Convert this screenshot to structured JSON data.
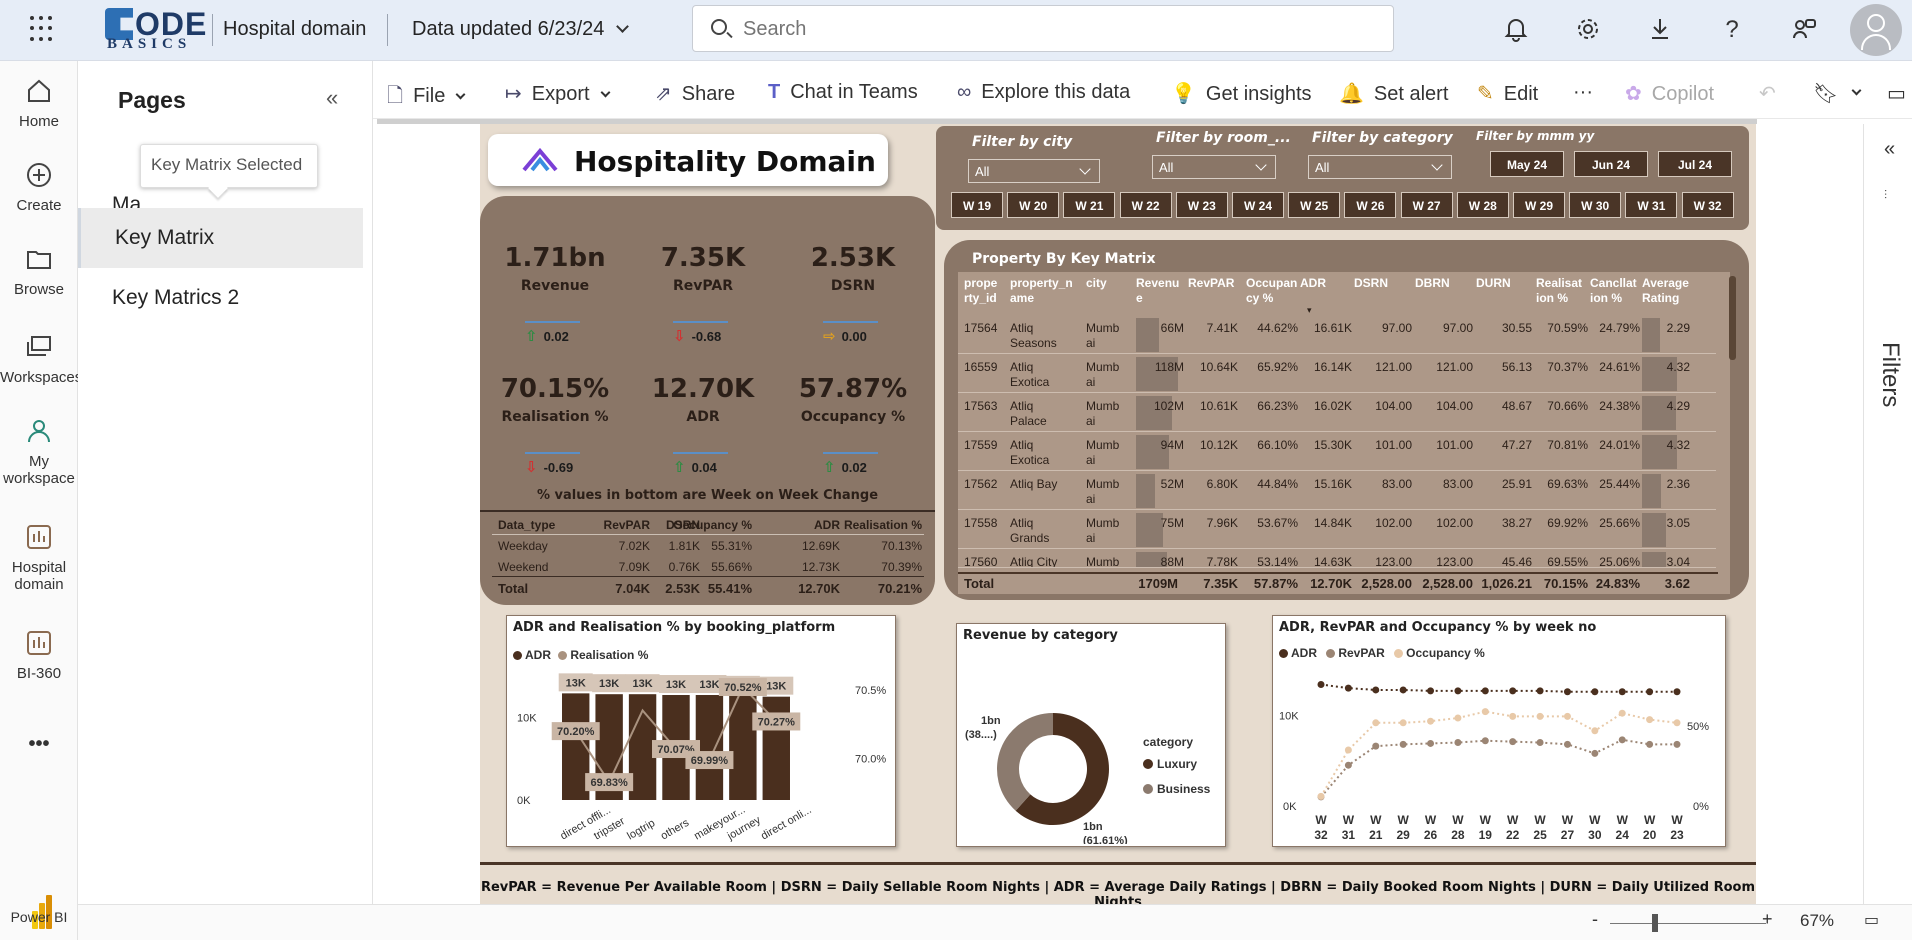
{
  "topbar": {
    "logo_main": "ODE",
    "logo_sub": "BASICS",
    "workspace": "Hospital domain",
    "data_updated": "Data updated 6/23/24",
    "search_placeholder": "Search"
  },
  "leftnav": {
    "home": "Home",
    "create": "Create",
    "browse": "Browse",
    "workspaces": "Workspaces",
    "my_ws_1": "My",
    "my_ws_2": "workspace",
    "hosp_1": "Hospital",
    "hosp_2": "domain",
    "bi360": "BI-360",
    "more": "•••",
    "powerbi": "Power BI"
  },
  "pages": {
    "title": "Pages",
    "collapse": "«",
    "item1": "Ma",
    "item2": "Key Matrix",
    "item3": "Key Matrics 2",
    "tooltip": "Key Matrix Selected"
  },
  "actions": {
    "file": "File",
    "export": "Export",
    "share": "Share",
    "teams": "Chat in Teams",
    "explore": "Explore this data",
    "insights": "Get insights",
    "alert": "Set alert",
    "edit": "Edit",
    "more": "···",
    "copilot": "Copilot"
  },
  "report": {
    "brand": "Hospitality Domain",
    "kpis": [
      {
        "value": "1.71bn",
        "label": "Revenue",
        "delta": "0.02",
        "dir": "up"
      },
      {
        "value": "7.35K",
        "label": "RevPAR",
        "delta": "-0.68",
        "dir": "down"
      },
      {
        "value": "2.53K",
        "label": "DSRN",
        "delta": "0.00",
        "dir": "flat"
      },
      {
        "value": "70.15%",
        "label": "Realisation %",
        "delta": "-0.69",
        "dir": "down"
      },
      {
        "value": "12.70K",
        "label": "ADR",
        "delta": "0.04",
        "dir": "up"
      },
      {
        "value": "57.87%",
        "label": "Occupancy %",
        "delta": "0.02",
        "dir": "up"
      }
    ],
    "wow_note": "% values in bottom are Week on Week Change",
    "mini_table": {
      "headers": [
        "Data_type",
        "RevPAR",
        "DSRN",
        "Occupancy %",
        "ADR",
        "Realisation %"
      ],
      "rows": [
        [
          "Weekday",
          "7.02K",
          "1.81K",
          "55.31%",
          "12.69K",
          "70.13%"
        ],
        [
          "Weekend",
          "7.09K",
          "0.76K",
          "55.66%",
          "12.73K",
          "70.39%"
        ],
        [
          "Total",
          "7.04K",
          "2.53K",
          "55.41%",
          "12.70K",
          "70.21%"
        ]
      ]
    },
    "filters": {
      "city_label": "Filter by city",
      "city_value": "All",
      "room_label": "Filter by room_...",
      "room_value": "All",
      "category_label": "Filter by category",
      "category_value": "All",
      "month_label": "Filter by mmm yy",
      "months": [
        "May 24",
        "Jun 24",
        "Jul 24"
      ],
      "weeks": [
        "W 19",
        "W 20",
        "W 21",
        "W 22",
        "W 23",
        "W 24",
        "W 25",
        "W 26",
        "W 27",
        "W 28",
        "W 29",
        "W 30",
        "W 31",
        "W 32"
      ]
    },
    "property_table": {
      "title": "Property By Key Matrix",
      "headers": [
        "prope\nrty_id",
        "property_n\name",
        "city",
        "Revenu\ne",
        "RevPAR",
        "Occupan\ncy %",
        "ADR",
        "DSRN",
        "DBRN",
        "DURN",
        "Realisat\nion %",
        "Cancllat\nion %",
        "Average\nRating"
      ],
      "rows": [
        {
          "id": "17564",
          "name1": "Atliq",
          "name2": "Seasons",
          "city1": "Mumb",
          "city2": "ai",
          "revenue": "66M",
          "revpar": "7.41K",
          "occ": "44.62%",
          "adr": "16.61K",
          "dsrn": "97.00",
          "dbrn": "97.00",
          "durn": "30.55",
          "real": "70.59%",
          "canc": "24.79%",
          "rating": "2.29",
          "rev_val": 66,
          "rating_val": 2.29
        },
        {
          "id": "16559",
          "name1": "Atliq",
          "name2": "Exotica",
          "city1": "Mumb",
          "city2": "ai",
          "revenue": "118M",
          "revpar": "10.64K",
          "occ": "65.92%",
          "adr": "16.14K",
          "dsrn": "121.00",
          "dbrn": "121.00",
          "durn": "56.13",
          "real": "70.37%",
          "canc": "24.61%",
          "rating": "4.32",
          "rev_val": 118,
          "rating_val": 4.32
        },
        {
          "id": "17563",
          "name1": "Atliq",
          "name2": "Palace",
          "city1": "Mumb",
          "city2": "ai",
          "revenue": "102M",
          "revpar": "10.61K",
          "occ": "66.23%",
          "adr": "16.02K",
          "dsrn": "104.00",
          "dbrn": "104.00",
          "durn": "48.67",
          "real": "70.66%",
          "canc": "24.38%",
          "rating": "4.29",
          "rev_val": 102,
          "rating_val": 4.29
        },
        {
          "id": "17559",
          "name1": "Atliq",
          "name2": "Exotica",
          "city1": "Mumb",
          "city2": "ai",
          "revenue": "94M",
          "revpar": "10.12K",
          "occ": "66.10%",
          "adr": "15.30K",
          "dsrn": "101.00",
          "dbrn": "101.00",
          "durn": "47.27",
          "real": "70.81%",
          "canc": "24.01%",
          "rating": "4.32",
          "rev_val": 94,
          "rating_val": 4.32
        },
        {
          "id": "17562",
          "name1": "Atliq Bay",
          "name2": "",
          "city1": "Mumb",
          "city2": "ai",
          "revenue": "52M",
          "revpar": "6.80K",
          "occ": "44.84%",
          "adr": "15.16K",
          "dsrn": "83.00",
          "dbrn": "83.00",
          "durn": "25.91",
          "real": "69.63%",
          "canc": "25.44%",
          "rating": "2.36",
          "rev_val": 52,
          "rating_val": 2.36
        },
        {
          "id": "17558",
          "name1": "Atliq",
          "name2": "Grands",
          "city1": "Mumb",
          "city2": "ai",
          "revenue": "75M",
          "revpar": "7.96K",
          "occ": "53.67%",
          "adr": "14.84K",
          "dsrn": "102.00",
          "dbrn": "102.00",
          "durn": "38.27",
          "real": "69.92%",
          "canc": "25.66%",
          "rating": "3.05",
          "rev_val": 75,
          "rating_val": 3.05
        },
        {
          "id": "17560",
          "name1": "Atliq City",
          "name2": "",
          "city1": "Mumb",
          "city2": "",
          "revenue": "88M",
          "revpar": "7.78K",
          "occ": "53.14%",
          "adr": "14.63K",
          "dsrn": "123.00",
          "dbrn": "123.00",
          "durn": "45.46",
          "real": "69.55%",
          "canc": "25.06%",
          "rating": "3.04",
          "rev_val": 88,
          "rating_val": 3.04
        }
      ],
      "total": [
        "Total",
        "1709M",
        "7.35K",
        "57.87%",
        "12.70K",
        "2,528.00",
        "2,528.00",
        "1,026.21",
        "70.15%",
        "24.83%",
        "3.62"
      ]
    },
    "footer": "RevPAR = Revenue Per Available Room | DSRN = Daily Sellable Room Nights | ADR = Average Daily Ratings | DBRN = Daily Booked Room Nights | DURN = Daily Utilized Room Nights",
    "colors": {
      "dark": "#4a3527",
      "tan": "#c9b29b",
      "panel": "#8a7667",
      "bg": "#e7dccf"
    }
  },
  "chart_data": [
    {
      "type": "bar",
      "title": "ADR and Realisation % by booking_platform",
      "categories": [
        "direct offli...",
        "tripster",
        "logtrip",
        "others",
        "makeyour...",
        "journey",
        "direct onli..."
      ],
      "series": [
        {
          "name": "ADR",
          "values": [
            12.9,
            12.8,
            12.8,
            12.7,
            12.7,
            12.6,
            12.5
          ],
          "labels": [
            "13K",
            "13K",
            "13K",
            "13K",
            "13K",
            "13K",
            "13K"
          ],
          "color": "#4a2f1e"
        },
        {
          "name": "Realisation %",
          "values": [
            70.2,
            69.83,
            70.35,
            70.07,
            69.99,
            70.52,
            70.27
          ],
          "labels": [
            "70.20%",
            "69.83%",
            "",
            "70.07%",
            "69.99%",
            "70.52%",
            "70.27%"
          ],
          "color": "#a9927f"
        }
      ],
      "y_ticks": [
        "0K",
        "10K"
      ],
      "y2_ticks": [
        "70.0%",
        "70.5%"
      ],
      "ylim": [
        0,
        15
      ],
      "y2lim": [
        69.7,
        70.6
      ]
    },
    {
      "type": "pie",
      "title": "Revenue by category",
      "legend_title": "category",
      "slices": [
        {
          "name": "Luxury",
          "value": 61.61,
          "label1": "1bn",
          "label2": "(61.61%)",
          "color": "#4a2f1e"
        },
        {
          "name": "Business",
          "value": 38.39,
          "label1": "1bn",
          "label2": "(38....)",
          "color": "#8b7a6e"
        }
      ]
    },
    {
      "type": "line",
      "title": "ADR, RevPAR and Occupancy % by week no",
      "x": [
        "W\n32",
        "W\n31",
        "W\n21",
        "W\n29",
        "W\n26",
        "W\n28",
        "W\n19",
        "W\n22",
        "W\n25",
        "W\n27",
        "W\n30",
        "W\n24",
        "W\n20",
        "W\n23"
      ],
      "series": [
        {
          "name": "ADR",
          "values": [
            13.4,
            13.0,
            12.8,
            12.8,
            12.7,
            12.7,
            12.7,
            12.7,
            12.7,
            12.6,
            12.6,
            12.6,
            12.6,
            12.6
          ],
          "color": "#4a2f1e",
          "axis": "left"
        },
        {
          "name": "RevPAR",
          "values": [
            1.0,
            4.5,
            6.6,
            6.8,
            6.9,
            7.0,
            7.2,
            7.1,
            7.0,
            6.8,
            5.8,
            7.3,
            6.8,
            6.8
          ],
          "color": "#9b8574",
          "axis": "left"
        },
        {
          "name": "Occupancy %",
          "values": [
            6,
            35,
            52,
            52,
            53,
            55,
            59,
            56,
            56,
            56,
            47,
            58,
            54,
            52
          ],
          "color": "#e8c9a8",
          "axis": "right"
        }
      ],
      "y_ticks": [
        "0K",
        "10K"
      ],
      "y2_ticks": [
        "0%",
        "50%"
      ],
      "ylim": [
        0,
        15
      ],
      "y2lim": [
        0,
        85
      ]
    }
  ],
  "statusbar": {
    "minus": "-",
    "plus": "+",
    "zoom": "67%"
  },
  "filters_pane": {
    "label": "Filters",
    "chevron": "«"
  }
}
